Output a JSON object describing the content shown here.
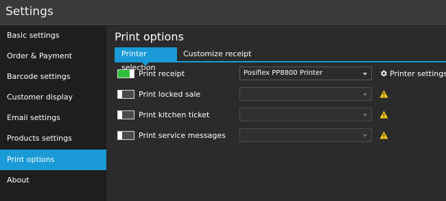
{
  "window": {
    "title": "Settings"
  },
  "sidebar": {
    "items": [
      {
        "label": "Basic settings",
        "active": false
      },
      {
        "label": "Order & Payment",
        "active": false
      },
      {
        "label": "Barcode settings",
        "active": false
      },
      {
        "label": "Customer display",
        "active": false
      },
      {
        "label": "Email settings",
        "active": false
      },
      {
        "label": "Products settings",
        "active": false
      },
      {
        "label": "Print options",
        "active": true
      },
      {
        "label": "About",
        "active": false
      }
    ]
  },
  "main": {
    "title": "Print options",
    "tabs": [
      {
        "label": "Printer selection",
        "active": true
      },
      {
        "label": "Customize receipt",
        "active": false
      }
    ],
    "options": [
      {
        "label": "Print receipt",
        "enabled": true,
        "printer": "Posiflex PP8800 Printer",
        "action": "Printer settings",
        "icon": "gear-icon"
      },
      {
        "label": "Print locked sale",
        "enabled": false,
        "printer": "",
        "icon": "warning-icon"
      },
      {
        "label": "Print kitchen ticket",
        "enabled": false,
        "printer": "",
        "icon": "warning-icon"
      },
      {
        "label": "Print service messages",
        "enabled": false,
        "printer": "",
        "icon": "warning-icon"
      }
    ]
  },
  "colors": {
    "accent": "#1a9ad6",
    "toggle_on": "#2fbf3a",
    "warning": "#f5c518"
  }
}
